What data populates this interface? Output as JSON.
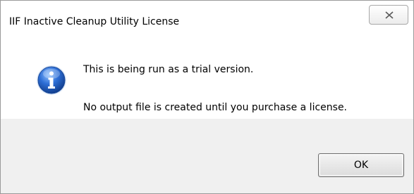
{
  "window": {
    "title": "IIF Inactive Cleanup Utility License"
  },
  "title_bar": {
    "close_icon": "close-icon"
  },
  "message": {
    "icon": "info-icon",
    "line1": "This is being run as a trial version.",
    "line2": "No output file is created until you purchase a license."
  },
  "buttons": {
    "ok_label": "OK"
  },
  "colors": {
    "footer_background": "#f0f0f0",
    "info_icon_blue": "#1f5fbf"
  }
}
